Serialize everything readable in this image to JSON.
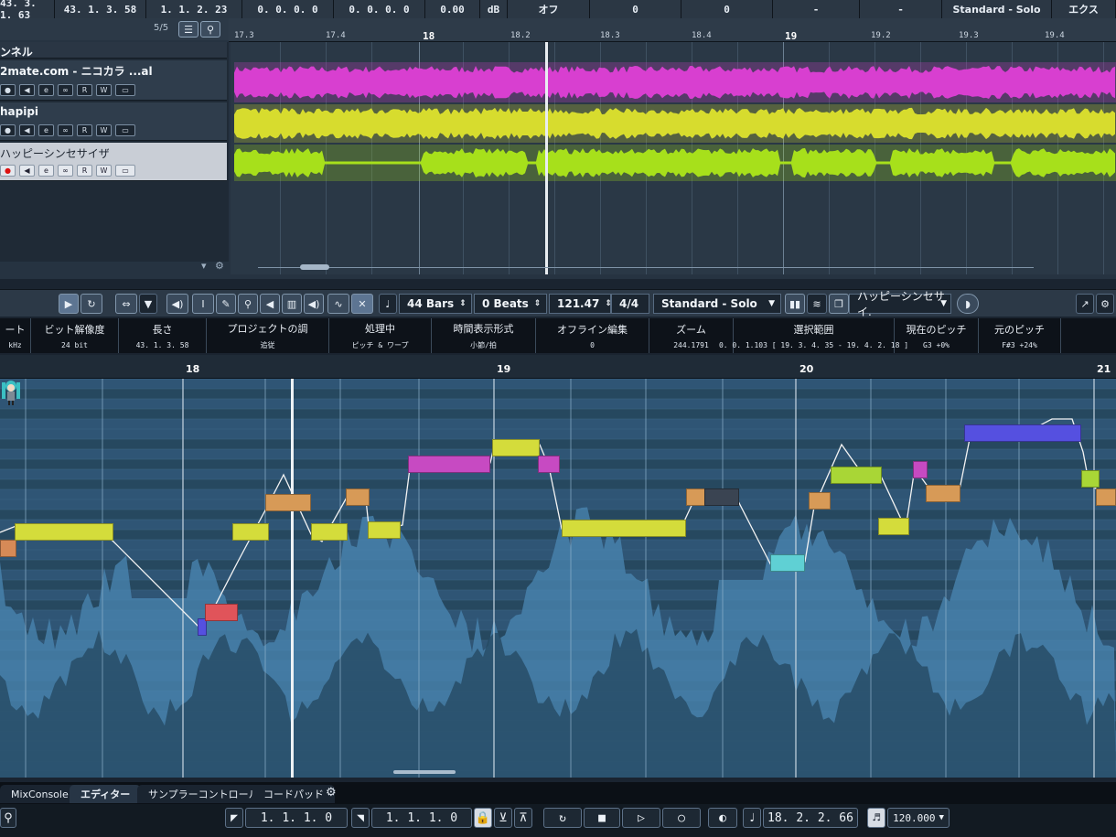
{
  "top_info": {
    "cells": [
      "43. 3. 1. 63",
      "43. 1. 3. 58",
      "1. 1. 2. 23",
      "0. 0. 0. 0",
      "0. 0. 0. 0",
      "0.00",
      "dB",
      "オフ",
      "0",
      "0",
      "-",
      "-",
      "Standard - Solo",
      "エクス"
    ]
  },
  "tracks_panel": {
    "count": "5/5",
    "header_label": "ンネル",
    "tracks": [
      {
        "name": "2mate.com - ニコカラ ...al",
        "selected": false
      },
      {
        "name": "hapipi",
        "selected": false
      },
      {
        "name": "ハッピーシンセサイザ",
        "selected": true
      }
    ],
    "button_labels": [
      "●",
      "◀",
      "e",
      "∞",
      "R",
      "W",
      "▭"
    ]
  },
  "arrange_ruler": [
    "17.3",
    "17.4",
    "18",
    "18.2",
    "18.3",
    "18.4",
    "19",
    "19.2",
    "19.3",
    "19.4"
  ],
  "toolbar": {
    "length_bars": "44 Bars",
    "offset_beats": "0 Beats",
    "tempo": "121.47",
    "signature": "4/4",
    "mode": "Standard - Solo",
    "track_select": "ハッピーシンセサイ."
  },
  "info_line": [
    {
      "label": "ート",
      "value": "kHz"
    },
    {
      "label": "ビット解像度",
      "value": "24                bit"
    },
    {
      "label": "長さ",
      "value": "43. 1. 3. 58"
    },
    {
      "label": "プロジェクトの調",
      "value": "追従"
    },
    {
      "label": "処理中",
      "value": "ピッチ & ワープ"
    },
    {
      "label": "時間表示形式",
      "value": "小節/拍"
    },
    {
      "label": "オフライン編集",
      "value": "0"
    },
    {
      "label": "ズーム",
      "value": "244.1791"
    },
    {
      "label": "選択範囲",
      "value": "0. 0. 1.103 [ 19. 3. 4. 35 - 19. 4. 2. 18 ]"
    },
    {
      "label": "現在のピッチ",
      "value": "G3 +0%"
    },
    {
      "label": "元のピッチ",
      "value": "F#3 +24%"
    }
  ],
  "editor_ruler": [
    "18",
    "19",
    "20",
    "21"
  ],
  "bottom_tabs": [
    "MixConsole",
    "エディター",
    "サンプラーコントロール",
    "コードパッド"
  ],
  "transport": {
    "left_locator": "1. 1. 1. 0",
    "right_locator": "1. 1. 1. 0",
    "position": "18. 2. 2. 66",
    "tempo": "120.000"
  },
  "colors": {
    "magenta_wave": "#d83fd0",
    "yellow_wave": "#d7dc2e",
    "lime_wave": "#a7e01b",
    "note_yellow": "#d4dc3b",
    "note_orange": "#d79a57",
    "note_magenta": "#c74ac2",
    "note_red": "#e0545a",
    "note_lime": "#a9d636",
    "note_cyan": "#5fd0d4",
    "note_blue": "#5550e0"
  }
}
